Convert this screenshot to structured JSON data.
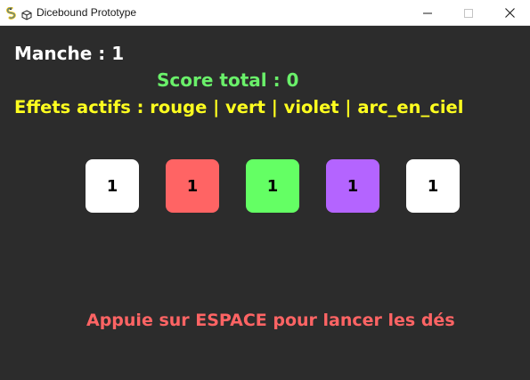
{
  "window": {
    "title": "Dicebound Prototype",
    "app_icon": "pygame-snake-icon",
    "secondary_icon": "dice-icon",
    "minimize_glyph": "—",
    "maximize_glyph": "☐",
    "close_glyph": "✕"
  },
  "hud": {
    "round_text": "Manche : 1",
    "score_text": "Score total : 0",
    "effects_text": "Effets actifs : rouge | vert | violet | arc_en_ciel"
  },
  "dice": [
    {
      "value": "1",
      "color": "#ffffff",
      "effect": "normal"
    },
    {
      "value": "1",
      "color": "#ff6464",
      "effect": "rouge"
    },
    {
      "value": "1",
      "color": "#64ff64",
      "effect": "vert"
    },
    {
      "value": "1",
      "color": "#b464ff",
      "effect": "violet"
    },
    {
      "value": "1",
      "color": "#ffffff",
      "effect": "normal"
    }
  ],
  "prompt": {
    "text": "Appuie sur ESPACE pour lancer les dés"
  },
  "colors": {
    "background": "#2c2c2c",
    "round": "#ffffff",
    "score": "#6af06a",
    "effects": "#ffff1f",
    "prompt": "#ff6464"
  }
}
